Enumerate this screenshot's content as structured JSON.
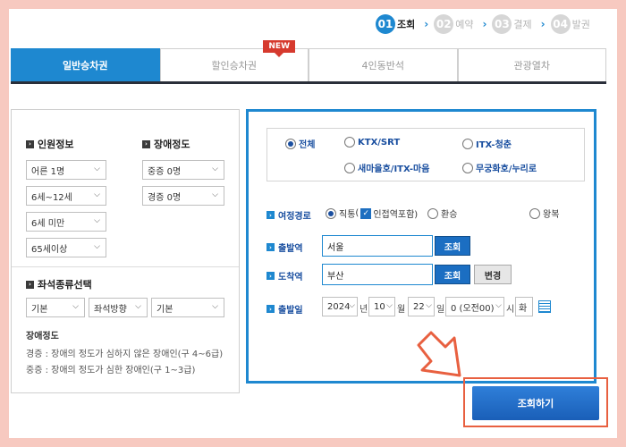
{
  "steps": [
    {
      "num": "01",
      "label": "조회",
      "active": true
    },
    {
      "num": "02",
      "label": "예약",
      "active": false
    },
    {
      "num": "03",
      "label": "결제",
      "active": false
    },
    {
      "num": "04",
      "label": "발권",
      "active": false
    }
  ],
  "tabs": [
    {
      "label": "일반승차권"
    },
    {
      "label": "할인승차권",
      "badge": "NEW"
    },
    {
      "label": "4인동반석"
    },
    {
      "label": "관광열차"
    }
  ],
  "passenger": {
    "title": "인원정보",
    "adult": "어른 1명",
    "child": "6세~12세",
    "infant": "6세 미만",
    "senior": "65세이상"
  },
  "disability": {
    "title": "장애정도",
    "severe": "중증 0명",
    "mild": "경증 0명"
  },
  "seat": {
    "title": "좌석종류선택",
    "type": "기본",
    "direction": "좌석방향",
    "extra": "기본"
  },
  "disability_note": {
    "title": "장애정도",
    "mild": "경증 : 장애의 정도가 심하지 않은 장애인(구 4~6급)",
    "severe": "중증 : 장애의 정도가 심한 장애인(구 1~3급)"
  },
  "train_types": [
    {
      "label": "전체",
      "selected": true
    },
    {
      "label": "KTX/SRT",
      "selected": false
    },
    {
      "label": "ITX-청춘",
      "selected": false
    },
    {
      "label": "새마을호/ITX-마음",
      "selected": false
    },
    {
      "label": "무궁화호/누리로",
      "selected": false
    }
  ],
  "route": {
    "label": "여정경로",
    "direct": "직통",
    "nearby_prefix": "(",
    "nearby": "인접역포함)",
    "transfer": "환승",
    "roundtrip": "왕복"
  },
  "departure": {
    "label": "출발역",
    "value": "서울",
    "button": "조회"
  },
  "arrival": {
    "label": "도착역",
    "value": "부산",
    "button": "조회",
    "swap": "변경"
  },
  "date": {
    "label": "출발일",
    "year": "2024",
    "year_unit": "년",
    "month": "10",
    "month_unit": "월",
    "day": "22",
    "day_unit": "일",
    "hour": "0 (오전00)",
    "hour_unit": "시",
    "weekday": "화"
  },
  "search_button": "조회하기",
  "colors": {
    "primary": "#1e88d0",
    "highlight": "#e86040",
    "background": "#f7c9c0"
  }
}
